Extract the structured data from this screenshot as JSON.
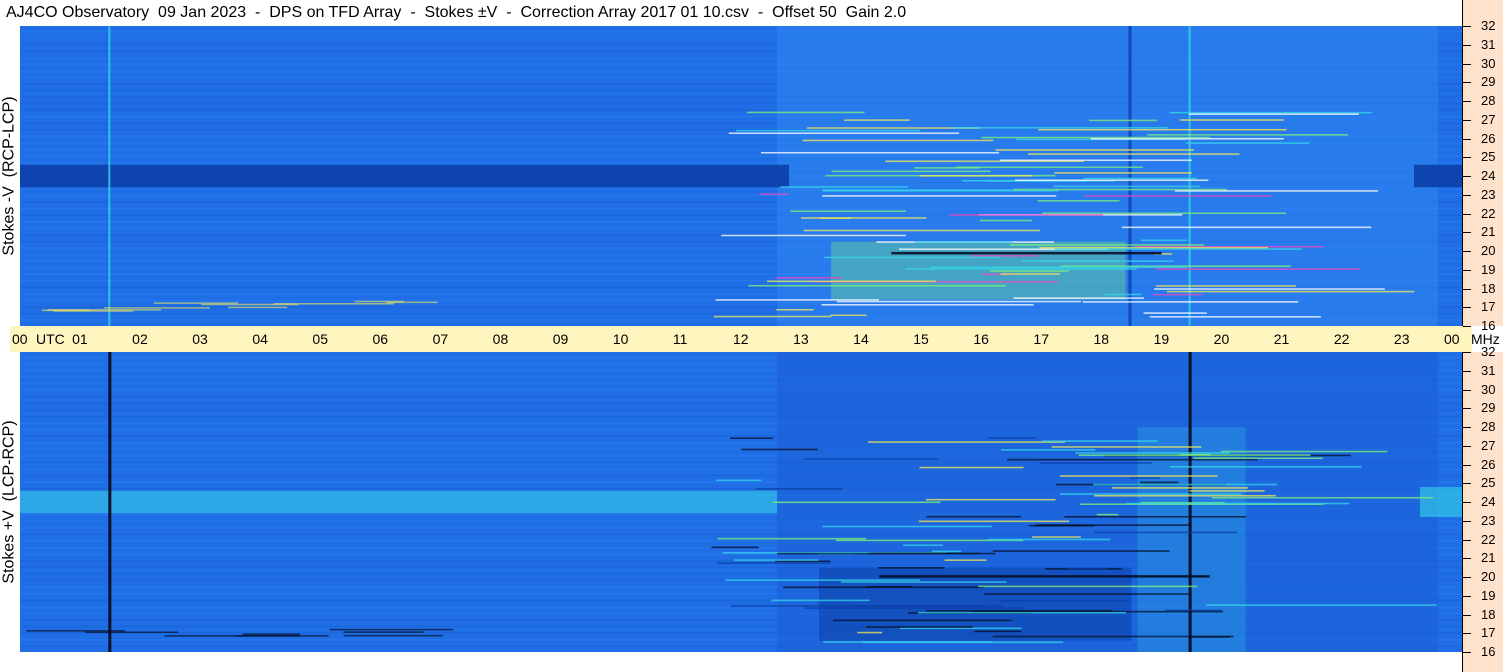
{
  "title": "AJ4CO Observatory  09 Jan 2023  -  DPS on TFD Array  -  Stokes ±V  -  Correction Array 2017 01 10.csv  -  Offset 50  Gain 2.0",
  "colors": {
    "base": "#1f6ee6",
    "dark": "#0b3fa8",
    "cyan": "#35d6e8",
    "green": "#7cf07a",
    "yellow": "#f0e65a",
    "magenta": "#e84ac0",
    "black": "#05102a",
    "time_axis_bg": "#fff6bf",
    "freq_axis_bg": "#ffe2cc"
  },
  "chart_data": [
    {
      "type": "heatmap",
      "ylabel": "Stokes -V  (RCP-LCP)",
      "x_range": [
        0,
        24
      ],
      "y_range": [
        16,
        32
      ],
      "y_ticks": [
        "32",
        "31",
        "30",
        "29",
        "28",
        "27",
        "26",
        "25",
        "24",
        "23",
        "22",
        "21",
        "20",
        "19",
        "18",
        "17",
        "16"
      ],
      "notes": "Dark band at 24 MHz across the day; bright green/yellow/magenta interference lines 17-21 MHz from ~12 to 19 UTC"
    },
    {
      "type": "heatmap",
      "ylabel": "Stokes +V  (LCP-RCP)",
      "x_range": [
        0,
        24
      ],
      "y_range": [
        16,
        32
      ],
      "y_ticks": [
        "32",
        "31",
        "30",
        "29",
        "28",
        "27",
        "26",
        "25",
        "24",
        "23",
        "22",
        "21",
        "20",
        "19",
        "18",
        "17",
        "16"
      ],
      "notes": "Cyan band at 24 MHz 00-12 UTC; dark interference lines 17-21 MHz from ~13 to 20 UTC"
    }
  ],
  "time_axis": {
    "labels": [
      "00",
      "01",
      "02",
      "03",
      "04",
      "05",
      "06",
      "07",
      "08",
      "09",
      "10",
      "11",
      "12",
      "13",
      "14",
      "15",
      "16",
      "17",
      "18",
      "19",
      "20",
      "21",
      "22",
      "23",
      "00"
    ],
    "utc_label": "UTC"
  },
  "freq_unit": "MHz"
}
